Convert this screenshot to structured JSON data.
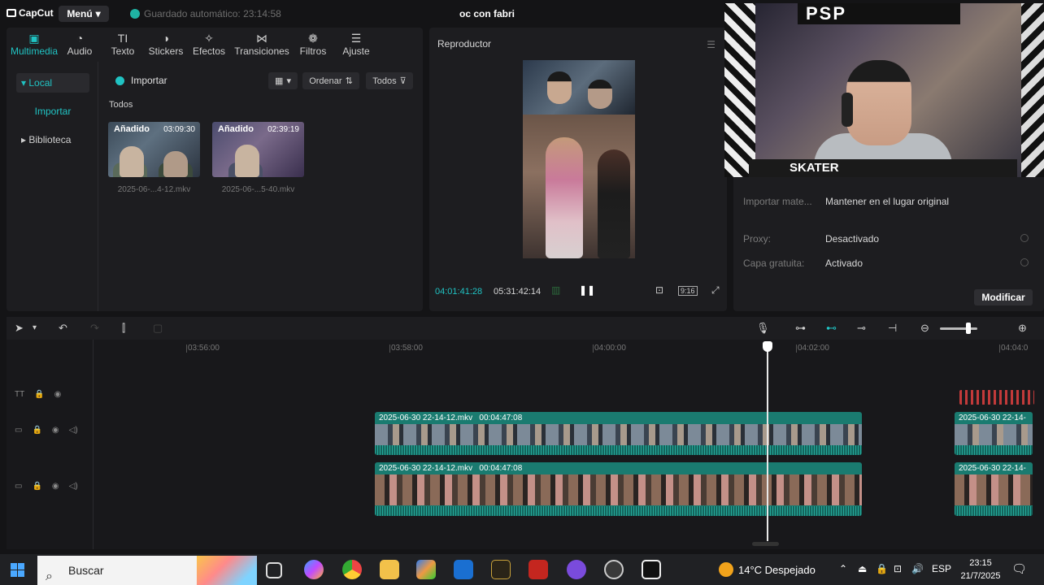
{
  "header": {
    "logo": "CapCut",
    "menu_label": "Menú",
    "autosave_text": "Guardado automático: 23:14:58",
    "project_title": "oc con fabri"
  },
  "media_tabs": [
    {
      "label": "Multimedia",
      "icon": "media-icon",
      "glyph": "▣"
    },
    {
      "label": "Audio",
      "icon": "audio-icon",
      "glyph": "◔"
    },
    {
      "label": "Texto",
      "icon": "text-icon",
      "glyph": "TI"
    },
    {
      "label": "Stickers",
      "icon": "sticker-icon",
      "glyph": "◑"
    },
    {
      "label": "Efectos",
      "icon": "effects-icon",
      "glyph": "✧"
    },
    {
      "label": "Transiciones",
      "icon": "transitions-icon",
      "glyph": "⋈"
    },
    {
      "label": "Filtros",
      "icon": "filters-icon",
      "glyph": "❁"
    },
    {
      "label": "Ajuste",
      "icon": "adjust-icon",
      "glyph": "☰"
    }
  ],
  "sidebar": {
    "local": "Local",
    "import": "Importar",
    "library": "Biblioteca"
  },
  "media": {
    "import_label": "Importar",
    "sort_label": "Ordenar",
    "filter_label": "Todos",
    "section_label": "Todos",
    "items": [
      {
        "badge": "Añadido",
        "duration": "03:09:30",
        "filename": "2025-06-...4-12.mkv"
      },
      {
        "badge": "Añadido",
        "duration": "02:39:19",
        "filename": "2025-06-...5-40.mkv"
      }
    ]
  },
  "player": {
    "title": "Reproductor",
    "current_time": "04:01:41:28",
    "total_time": "05:31:42:14",
    "ratio": "9:16"
  },
  "properties": {
    "rows": [
      {
        "label": "Importar mate...",
        "value": "Mantener en el lugar original"
      },
      {
        "label": "Proxy:",
        "value": "Desactivado"
      },
      {
        "label": "Capa gratuita:",
        "value": "Activado"
      }
    ],
    "modify_label": "Modificar",
    "webcam_text_top": "PSP",
    "webcam_text_bottom": "SKATER"
  },
  "timeline": {
    "ruler": [
      "03:56:00",
      "03:58:00",
      "04:00:00",
      "04:02:00",
      "04:04:0"
    ],
    "clips": [
      {
        "name": "2025-06-30 22-14-12.mkv",
        "duration": "00:04:47:08"
      },
      {
        "name": "2025-06-30 22-14-12.mkv",
        "duration": "00:04:47:08"
      },
      {
        "name": "2025-06-30 22-14-",
        "duration": ""
      },
      {
        "name": "2025-06-30 22-14-",
        "duration": ""
      }
    ]
  },
  "taskbar": {
    "search_placeholder": "Buscar",
    "weather": "14°C  Despejado",
    "language": "ESP",
    "time": "23:15",
    "date": "21/7/2025"
  },
  "colors": {
    "accent": "#20c3c3",
    "clip": "#1a7b70",
    "panel": "#1d1d20",
    "background": "#141416"
  }
}
